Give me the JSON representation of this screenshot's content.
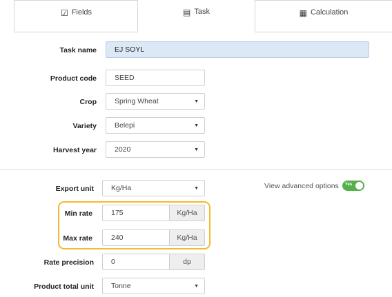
{
  "tabs": [
    {
      "label": "Fields",
      "icon": "checkbox-icon"
    },
    {
      "label": "Task",
      "icon": "task-icon"
    },
    {
      "label": "Calculation",
      "icon": "calculator-icon"
    }
  ],
  "form": {
    "task_name": {
      "label": "Task name",
      "value": "EJ SOYL"
    },
    "product_code": {
      "label": "Product code",
      "value": "SEED"
    },
    "crop": {
      "label": "Crop",
      "value": "Spring Wheat"
    },
    "variety": {
      "label": "Variety",
      "value": "Belepi"
    },
    "harvest_year": {
      "label": "Harvest year",
      "value": "2020"
    },
    "export_unit": {
      "label": "Export unit",
      "value": "Kg/Ha"
    },
    "min_rate": {
      "label": "Min rate",
      "value": "175",
      "unit": "Kg/Ha"
    },
    "max_rate": {
      "label": "Max rate",
      "value": "240",
      "unit": "Kg/Ha"
    },
    "rate_precision": {
      "label": "Rate precision",
      "value": "0",
      "unit": "dp"
    },
    "product_total_unit": {
      "label": "Product total unit",
      "value": "Tonne"
    }
  },
  "advanced": {
    "label": "View advanced options",
    "toggle_text": "Yes",
    "enabled": true
  },
  "colors": {
    "highlight": "#f5b92e",
    "toggle_on": "#54b04a",
    "active_field": "#dde8f7"
  }
}
